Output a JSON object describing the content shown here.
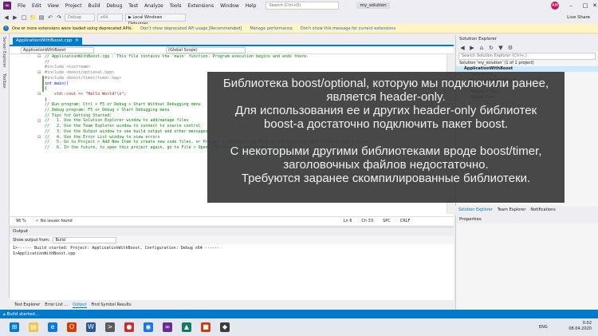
{
  "menubar": {
    "items": [
      "File",
      "Edit",
      "View",
      "Project",
      "Build",
      "Debug",
      "Test",
      "Analyze",
      "Tools",
      "Extensions",
      "Window",
      "Help"
    ],
    "search_placeholder": "Search (Ctrl+Q)",
    "solution_name": "my_solution",
    "avatar_initials": "AM"
  },
  "toolbar": {
    "config": "Debug",
    "platform": "x64",
    "debugger": "▶ Local Windows Debugger",
    "live_share": "Live Share"
  },
  "infobar": {
    "message": "One or more extensions were loaded using deprecated APIs.",
    "link1": "Don't show deprecated API usage [Recommended]",
    "link2": "Manage performance",
    "link3": "Don't show this message for current extensions"
  },
  "left_tabs": [
    "Server Explorer",
    "Toolbox"
  ],
  "editor": {
    "tab_label": "ApplicationWithBoost.cpp",
    "nav_project": "ApplicationWithBoost",
    "nav_scope": "(Global Scope)",
    "status": {
      "zoom": "96 %",
      "issues": "No issues found",
      "line": "Ln 6",
      "col": "Ch 33",
      "mode": "SPC",
      "eol": "CRLF"
    }
  },
  "code_lines": [
    {
      "t": "// ApplicationWithBoost.cpp : This file contains the 'main' function. Program execution begins and ends there.",
      "c": "cm"
    },
    {
      "t": "//",
      "c": "cm"
    },
    {
      "t": "",
      "c": ""
    },
    {
      "t": "#include <iostream>",
      "c": "pp"
    },
    {
      "t": "#include <boost/optional.hpp>",
      "c": "pp"
    },
    {
      "t": "#include <boost/timer/timer.hpp>",
      "c": "pp"
    },
    {
      "t": "",
      "c": ""
    },
    {
      "t": "int main()",
      "c": "kw"
    },
    {
      "t": "{",
      "c": ""
    },
    {
      "t": "    std::cout << \"Hello World!\\n\";",
      "c": "str"
    },
    {
      "t": "}",
      "c": ""
    },
    {
      "t": "",
      "c": ""
    },
    {
      "t": "// Run program: Ctrl + F5 or Debug > Start Without Debugging menu",
      "c": "cm"
    },
    {
      "t": "// Debug program: F5 or Debug > Start Debugging menu",
      "c": "cm"
    },
    {
      "t": "",
      "c": ""
    },
    {
      "t": "// Tips for Getting Started:",
      "c": "cm"
    },
    {
      "t": "//   1. Use the Solution Explorer window to add/manage files",
      "c": "cm"
    },
    {
      "t": "//   2. Use the Team Explorer window to connect to source control",
      "c": "cm"
    },
    {
      "t": "//   3. Use the Output window to see build output and other messages",
      "c": "cm"
    },
    {
      "t": "//   4. Use the Error List window to view errors",
      "c": "cm"
    },
    {
      "t": "//   5. Go to Project > Add New Item to create new code files, or Project > Add Existing Item to add existing code files to the project",
      "c": "cm"
    },
    {
      "t": "//   6. In the future, to open this project again, go to File > Open > Project and select the .sln file",
      "c": "cm"
    }
  ],
  "solution_explorer": {
    "title": "Solution Explorer",
    "search_placeholder": "Search Solution Explorer (Ctrl+;)",
    "items": [
      "Solution 'my_solution' (1 of 1 project)",
      "ApplicationWithBoost",
      "References",
      "External Dependencies",
      "Header Files",
      "Resource Files",
      "Source Files"
    ],
    "tabs": [
      "Solution Explorer",
      "Team Explorer",
      "Notifications"
    ]
  },
  "properties": {
    "title": "Properties"
  },
  "output": {
    "title": "Output",
    "show_from_label": "Show output from:",
    "show_from_value": "Build",
    "lines": [
      "1>------ Build started: Project: ApplicationWithBoost, Configuration: Debug x64 ------",
      "1>ApplicationWithBoost.cpp"
    ]
  },
  "bottom_tabs": [
    "Test Explorer",
    "Error List ...",
    "Output",
    "Find Symbol Results"
  ],
  "statusbar": {
    "text": "Build started..."
  },
  "taskbar": {
    "time": "0:02",
    "date": "08.04.2020",
    "lang": "ENG"
  },
  "overlay": {
    "p1": [
      "Библиотека boost/optional, которую мы подключили ранее,",
      "является header-only.",
      "Для использования ее и других header-only  библиотек",
      "boost-а достаточно подключить пакет boost."
    ],
    "p2": [
      "С некоторыми другими библиотеками вроде boost/timer,",
      "заголовочных файлов недостаточно.",
      "Требуются заранее скомпилированные библиотеки."
    ]
  }
}
